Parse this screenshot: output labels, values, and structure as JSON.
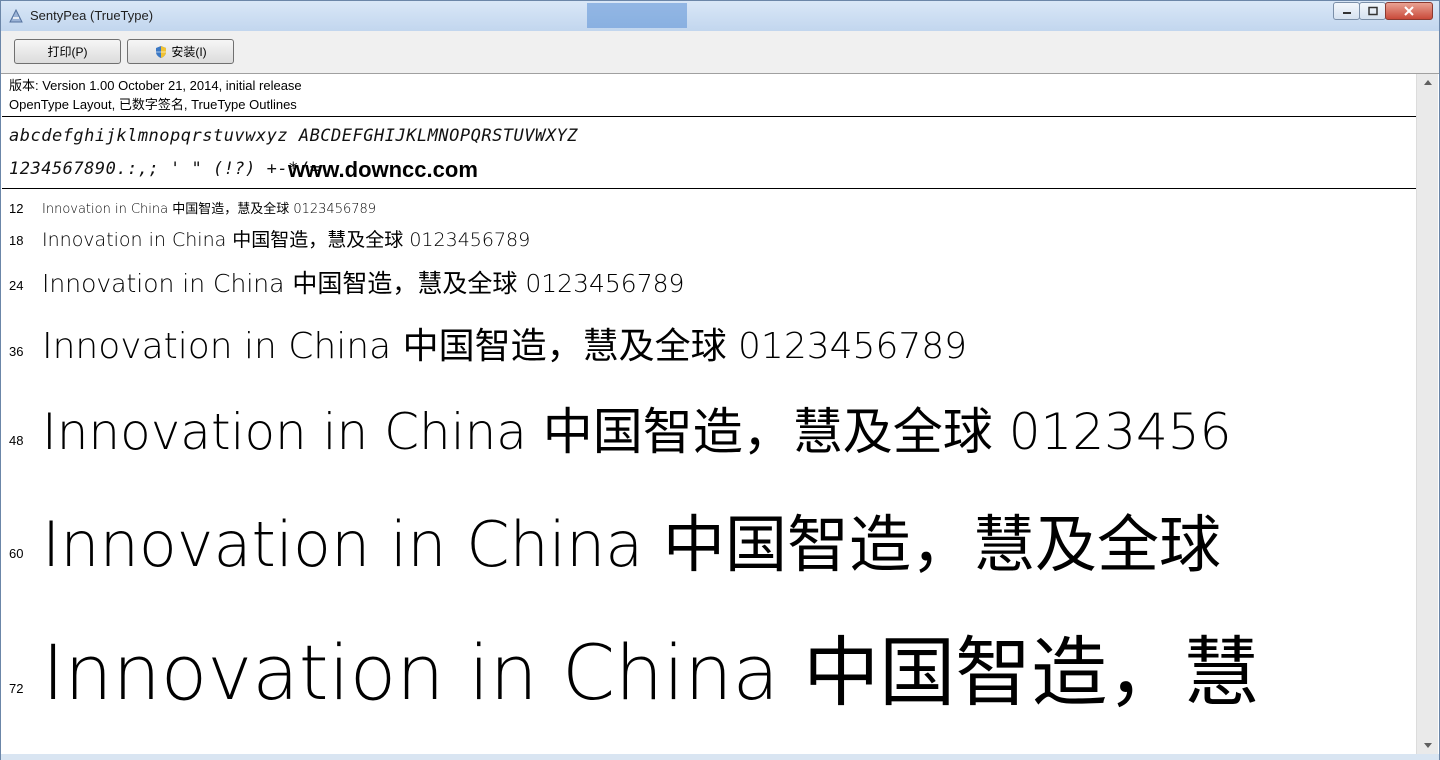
{
  "window": {
    "title": "SentyPea (TrueType)",
    "title_blurred_text": "",
    "controls": [
      "minimize-icon",
      "maximize-icon",
      "close-icon"
    ]
  },
  "toolbar": {
    "print_label": "打印(P)",
    "install_label": "安装(I)"
  },
  "font_info": {
    "version_line": "版本: Version 1.00 October 21, 2014, initial release",
    "features_line": "OpenType Layout, 已数字签名, TrueType Outlines"
  },
  "charset": {
    "alphabet": "abcdefghijklmnopqrstuvwxyz ABCDEFGHIJKLMNOPQRSTUVWXYZ",
    "digits_symbols": "1234567890.:,; ' \" (!?) +-*/=",
    "watermark": "www.downcc.com"
  },
  "samples": {
    "sample_text_12": "Innovation in China 中国智造，慧及全球 0123456789",
    "sample_text_18": "Innovation in China 中国智造，慧及全球 0123456789",
    "sample_text_24": "Innovation in China 中国智造，慧及全球 0123456789",
    "sample_text_36": "Innovation in China 中国智造，慧及全球 0123456789",
    "sample_text_48": "Innovation in China 中国智造，慧及全球 0123456",
    "sample_text_60": "Innovation in China 中国智造，慧及全球",
    "sample_text_72": "Innovation in China 中国智造，慧",
    "sizes": [
      {
        "size": "12"
      },
      {
        "size": "18"
      },
      {
        "size": "24"
      },
      {
        "size": "36"
      },
      {
        "size": "48"
      },
      {
        "size": "60"
      },
      {
        "size": "72"
      }
    ]
  },
  "colors": {
    "titlebar": "#c8dbf0",
    "close_button": "#c94a3a",
    "text": "#000000"
  }
}
